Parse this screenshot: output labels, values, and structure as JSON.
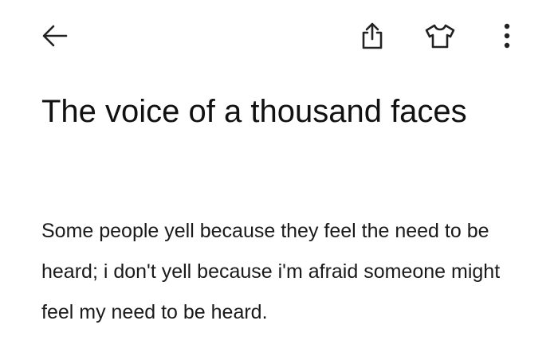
{
  "toolbar": {
    "back_icon": "arrow-left-icon",
    "share_icon": "share-icon",
    "theme_icon": "tshirt-icon",
    "more_icon": "more-vertical-icon"
  },
  "note": {
    "title": "The voice of a thousand faces",
    "body": "Some people yell because they feel the need to be heard; i don't yell because i'm afraid someone might feel my need to be heard."
  },
  "colors": {
    "background": "#ffffff",
    "text": "#111111",
    "icon": "#222222"
  }
}
